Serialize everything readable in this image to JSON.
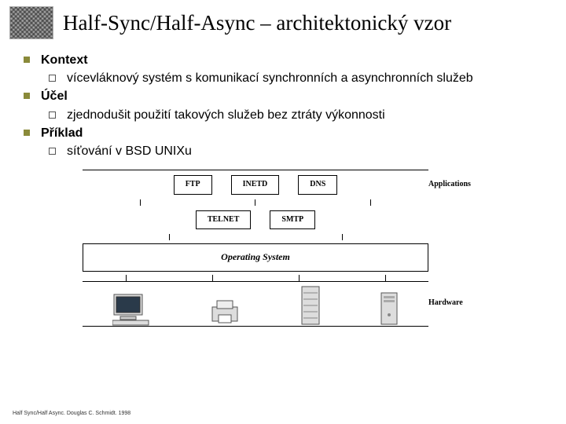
{
  "title": "Half-Sync/Half-Async – architektonický vzor",
  "bullets": {
    "b1": "Kontext",
    "b1a": "vícevláknový systém s komunikací synchronních a asynchronních služeb",
    "b2": "Účel",
    "b2a": "zjednodušit použití takových služeb bez ztráty výkonnosti",
    "b3": "Příklad",
    "b3a": "síťování v BSD UNIXu"
  },
  "diagram": {
    "row1": {
      "a": "FTP",
      "b": "INETD",
      "c": "DNS"
    },
    "row2": {
      "a": "TELNET",
      "b": "SMTP"
    },
    "label_apps": "Applications",
    "os": "Operating System",
    "label_hw": "Hardware"
  },
  "footer": "Half Sync/Half Async. Douglas C. Schmidt. 1998"
}
